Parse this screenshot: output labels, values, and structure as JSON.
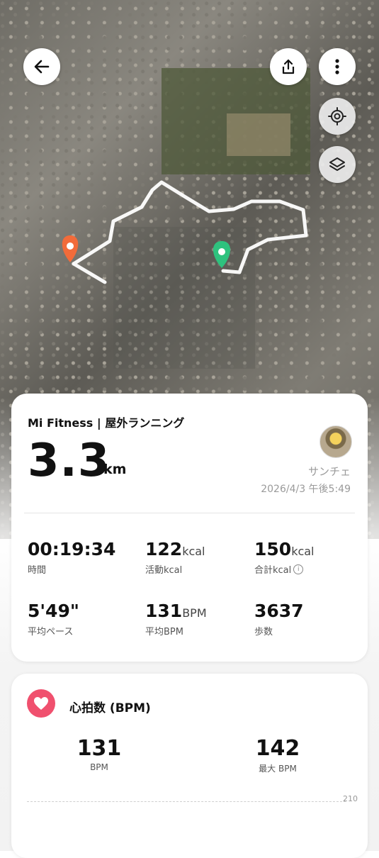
{
  "map": {
    "start_pin_color": "#f26b3a",
    "end_pin_color": "#2ec27e",
    "route_color": "#ffffff"
  },
  "toolbar": {
    "back_icon": "arrow-left-icon",
    "share_icon": "share-icon",
    "more_icon": "more-vertical-icon",
    "locate_icon": "locate-icon",
    "layers_icon": "layers-icon"
  },
  "summary": {
    "source": "Mi Fitness | 屋外ランニング",
    "distance_value": "3.3",
    "distance_unit": "km",
    "user_name": "サンチェ",
    "datetime": "2026/4/3 午後5:49",
    "stats": [
      {
        "value": "00:19:34",
        "unit": "",
        "label": "時間",
        "info": false
      },
      {
        "value": "122",
        "unit": "kcal",
        "label": "活動kcal",
        "info": false
      },
      {
        "value": "150",
        "unit": "kcal",
        "label": "合計kcal",
        "info": true
      },
      {
        "value": "5'49\"",
        "unit": "",
        "label": "平均ペース",
        "info": false
      },
      {
        "value": "131",
        "unit": "BPM",
        "label": "平均BPM",
        "info": false
      },
      {
        "value": "3637",
        "unit": "",
        "label": "歩数",
        "info": false
      }
    ]
  },
  "heart_rate": {
    "title": "心拍数 (BPM)",
    "accent": "#f0506e",
    "avg_value": "131",
    "avg_label": "BPM",
    "max_value": "142",
    "max_label": "最大 BPM",
    "chart_tick": "210"
  }
}
